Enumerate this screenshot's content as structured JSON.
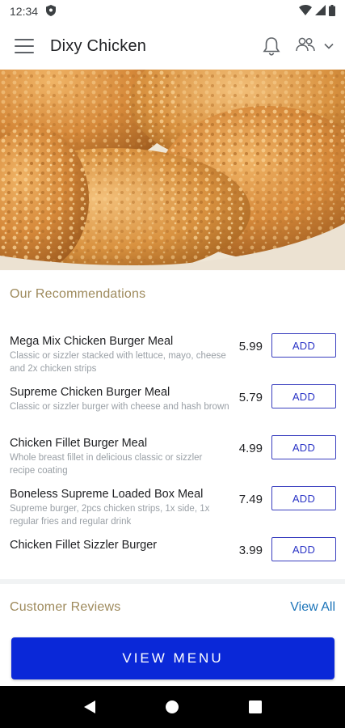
{
  "status_bar": {
    "time": "12:34"
  },
  "app_bar": {
    "title": "Dixy Chicken"
  },
  "recommendations": {
    "title": "Our Recommendations",
    "items": [
      {
        "name": "Mega Mix Chicken Burger Meal",
        "description": "Classic or sizzler stacked with lettuce, mayo, cheese and 2x chicken strips",
        "price": "5.99",
        "button": "ADD"
      },
      {
        "name": "Supreme Chicken Burger Meal",
        "description": "Classic or sizzler burger with cheese and hash brown",
        "price": "5.79",
        "button": "ADD"
      },
      {
        "name": "Chicken Fillet Burger Meal",
        "description": "Whole breast fillet in delicious classic or sizzler recipe coating",
        "price": "4.99",
        "button": "ADD"
      },
      {
        "name": "Boneless Supreme Loaded Box Meal",
        "description": "Supreme burger, 2pcs chicken strips, 1x side, 1x regular fries and regular drink",
        "price": "7.49",
        "button": "ADD"
      },
      {
        "name": "Chicken Fillet Sizzler Burger",
        "description": "",
        "price": "3.99",
        "button": "ADD"
      }
    ]
  },
  "reviews": {
    "title": "Customer Reviews",
    "view_all": "View All"
  },
  "cta": {
    "label": "VIEW MENU"
  },
  "colors": {
    "primary": "#0a28d8",
    "accent_text": "#9e8a5c",
    "link": "#1a73b8",
    "add_border": "#3a3fbf"
  },
  "icons": [
    "shield-icon",
    "wifi-icon",
    "cellular-icon",
    "battery-icon",
    "menu-icon",
    "bell-icon",
    "group-icon",
    "chevron-down-icon",
    "back-icon",
    "home-icon",
    "recents-icon"
  ]
}
